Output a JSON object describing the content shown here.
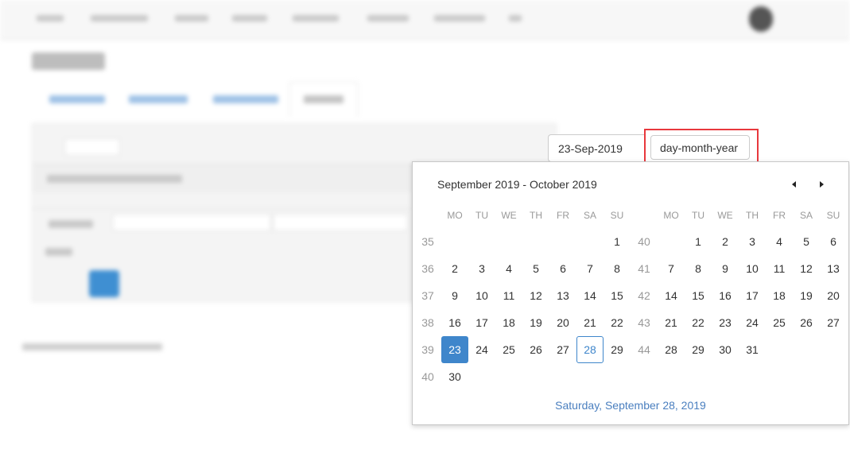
{
  "date_input": {
    "value": "23-Sep-2019"
  },
  "format_input": {
    "value": "day-month-year"
  },
  "calendar": {
    "header": "September 2019 - October 2019",
    "prev_icon": "caret-left-icon",
    "next_icon": "caret-right-icon",
    "weekdays": [
      "MO",
      "TU",
      "WE",
      "TH",
      "FR",
      "SA",
      "SU"
    ],
    "months": [
      {
        "name": "September 2019",
        "weeks": [
          {
            "wk": "35",
            "days": [
              "",
              "",
              "",
              "",
              "",
              "",
              "1"
            ]
          },
          {
            "wk": "36",
            "days": [
              "2",
              "3",
              "4",
              "5",
              "6",
              "7",
              "8"
            ]
          },
          {
            "wk": "37",
            "days": [
              "9",
              "10",
              "11",
              "12",
              "13",
              "14",
              "15"
            ]
          },
          {
            "wk": "38",
            "days": [
              "16",
              "17",
              "18",
              "19",
              "20",
              "21",
              "22"
            ]
          },
          {
            "wk": "39",
            "days": [
              "23",
              "24",
              "25",
              "26",
              "27",
              "28",
              "29"
            ]
          },
          {
            "wk": "40",
            "days": [
              "30",
              "",
              "",
              "",
              "",
              "",
              ""
            ]
          }
        ]
      },
      {
        "name": "October 2019",
        "weeks": [
          {
            "wk": "40",
            "days": [
              "",
              "1",
              "2",
              "3",
              "4",
              "5",
              "6"
            ]
          },
          {
            "wk": "41",
            "days": [
              "7",
              "8",
              "9",
              "10",
              "11",
              "12",
              "13"
            ]
          },
          {
            "wk": "42",
            "days": [
              "14",
              "15",
              "16",
              "17",
              "18",
              "19",
              "20"
            ]
          },
          {
            "wk": "43",
            "days": [
              "21",
              "22",
              "23",
              "24",
              "25",
              "26",
              "27"
            ]
          },
          {
            "wk": "44",
            "days": [
              "28",
              "29",
              "30",
              "31",
              "",
              "",
              ""
            ]
          }
        ]
      }
    ],
    "selected_day": "23",
    "today_day": "28",
    "footer": "Saturday, September 28, 2019"
  },
  "colors": {
    "accent": "#3f86cb",
    "highlight_border": "#e8383d",
    "footer_link": "#4a7fbf"
  }
}
